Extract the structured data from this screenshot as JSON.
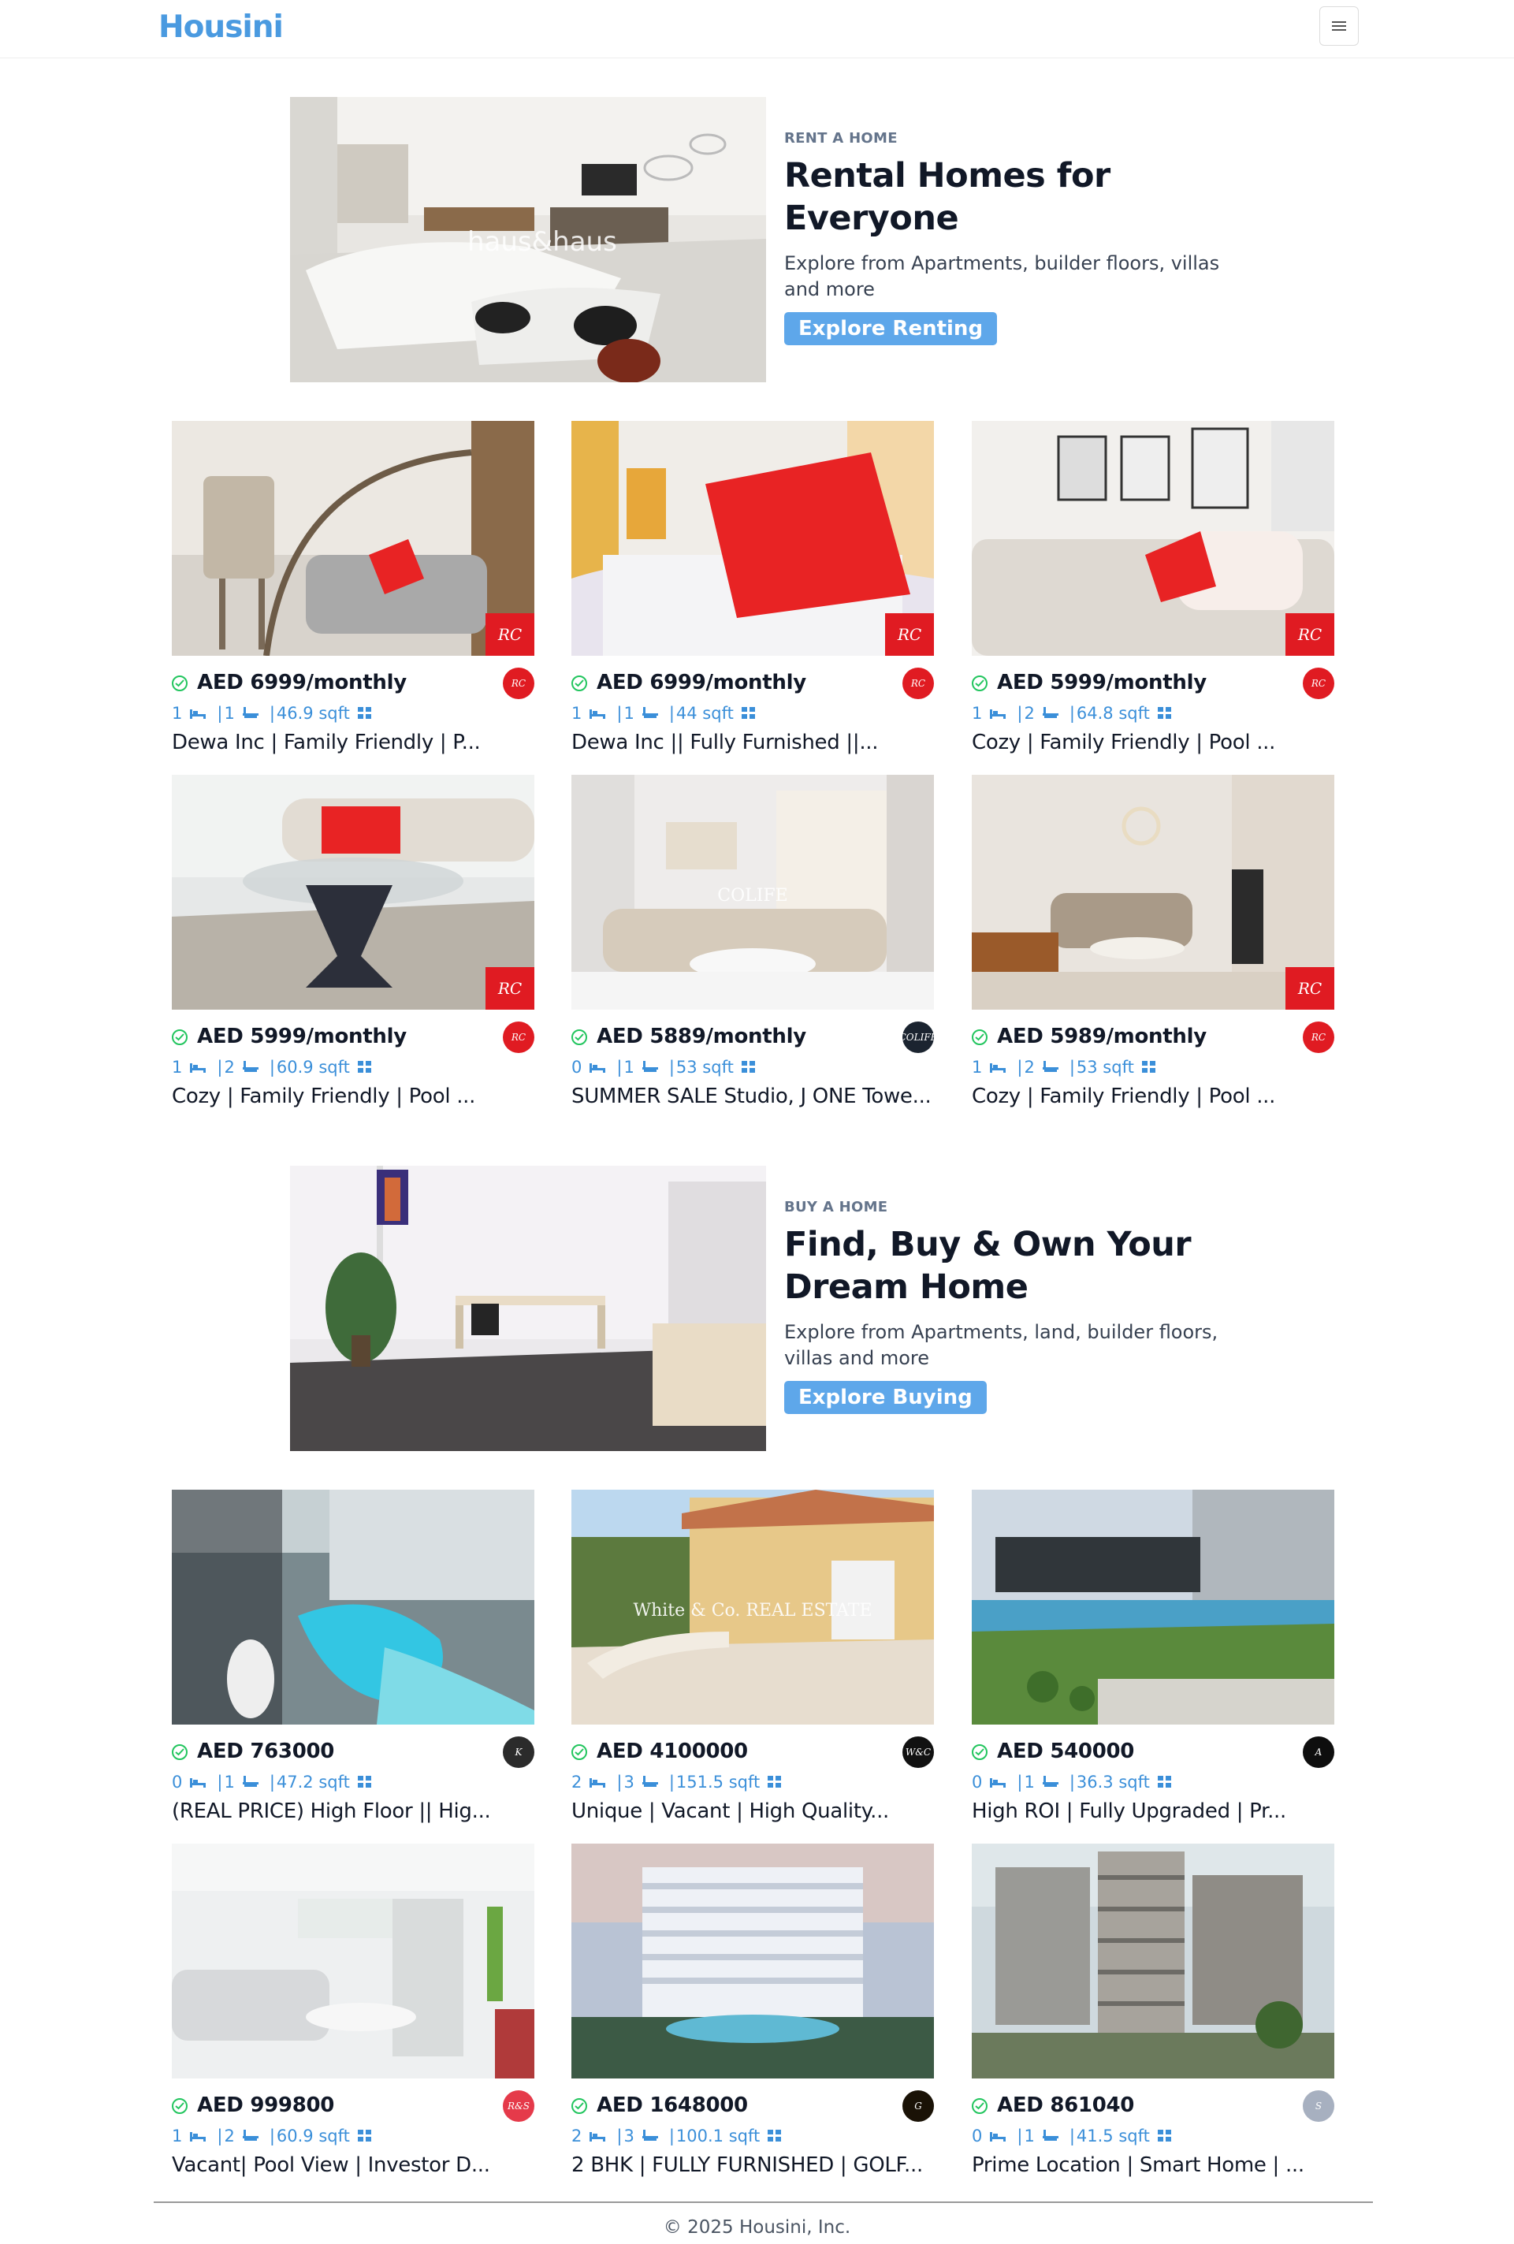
{
  "brand": {
    "name": "Housini",
    "color": "#4a9ae0"
  },
  "menu": {
    "icon": "menu-icon"
  },
  "rent_promo": {
    "eyebrow": "RENT A HOME",
    "title": "Rental Homes for Everyone",
    "description": "Explore from Apartments, builder floors, villas and more",
    "button": "Explore Renting",
    "image_watermark": "haus&haus"
  },
  "buy_promo": {
    "eyebrow": "BUY A HOME",
    "title": "Find, Buy & Own Your Dream Home",
    "description": "Explore from Apartments, land, builder floors, villas and more",
    "button": "Explore Buying"
  },
  "rent_listings": [
    {
      "price": "AED 6999/monthly",
      "beds": "1",
      "baths": "1",
      "area": "46.9 sqft",
      "title": "Dewa Inc | Family Friendly | P...",
      "logo": "RC"
    },
    {
      "price": "AED 6999/monthly",
      "beds": "1",
      "baths": "1",
      "area": "44 sqft",
      "title": "Dewa Inc || Fully Furnished ||...",
      "logo": "RC"
    },
    {
      "price": "AED 5999/monthly",
      "beds": "1",
      "baths": "2",
      "area": "64.8 sqft",
      "title": "Cozy | Family Friendly | Pool ...",
      "logo": "RC"
    },
    {
      "price": "AED 5999/monthly",
      "beds": "1",
      "baths": "2",
      "area": "60.9 sqft",
      "title": "Cozy | Family Friendly | Pool ...",
      "logo": "RC"
    },
    {
      "price": "AED 5889/monthly",
      "beds": "0",
      "baths": "1",
      "area": "53 sqft",
      "title": "SUMMER SALE Studio, J ONE Towe...",
      "logo": "COLIFE",
      "watermark": "COLIFE"
    },
    {
      "price": "AED 5989/monthly",
      "beds": "1",
      "baths": "2",
      "area": "53 sqft",
      "title": "Cozy | Family Friendly | Pool ...",
      "logo": "RC"
    }
  ],
  "buy_listings": [
    {
      "price": "AED 763000",
      "beds": "0",
      "baths": "1",
      "area": "47.2 sqft",
      "title": "(REAL PRICE) High Floor || Hig...",
      "logo": "K"
    },
    {
      "price": "AED 4100000",
      "beds": "2",
      "baths": "3",
      "area": "151.5 sqft",
      "title": "Unique | Vacant | High Quality...",
      "logo": "W&C",
      "watermark": "White & Co. REAL ESTATE"
    },
    {
      "price": "AED 540000",
      "beds": "0",
      "baths": "1",
      "area": "36.3 sqft",
      "title": "High ROI | Fully Upgraded | Pr...",
      "logo": "A"
    },
    {
      "price": "AED 999800",
      "beds": "1",
      "baths": "2",
      "area": "60.9 sqft",
      "title": "Vacant| Pool View | Investor D...",
      "logo": "R&S"
    },
    {
      "price": "AED 1648000",
      "beds": "2",
      "baths": "3",
      "area": "100.1 sqft",
      "title": "2 BHK | FULLY FURNISHED | GOLF...",
      "logo": "G"
    },
    {
      "price": "AED 861040",
      "beds": "0",
      "baths": "1",
      "area": "41.5 sqft",
      "title": "Prime Location | Smart Home | ...",
      "logo": "S"
    }
  ],
  "footer": {
    "copyright": "© 2025 Housini, Inc."
  }
}
